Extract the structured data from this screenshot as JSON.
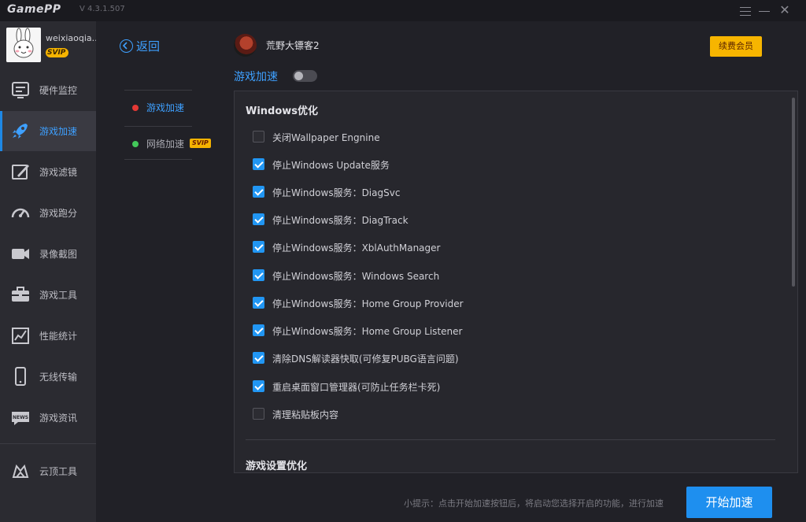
{
  "app": {
    "logo": "GamePP",
    "version": "V 4.3.1.507",
    "close_glyph": "✕"
  },
  "user": {
    "name": "weixiaoqia...",
    "badge": "SVIP"
  },
  "sidebar": {
    "items": [
      {
        "label": "硬件监控",
        "icon": "hardware-monitor-icon"
      },
      {
        "label": "游戏加速",
        "icon": "rocket-icon"
      },
      {
        "label": "游戏滤镜",
        "icon": "filter-brush-icon"
      },
      {
        "label": "游戏跑分",
        "icon": "speedometer-icon"
      },
      {
        "label": "录像截图",
        "icon": "video-camera-icon"
      },
      {
        "label": "游戏工具",
        "icon": "toolbox-icon"
      },
      {
        "label": "性能统计",
        "icon": "chart-icon"
      },
      {
        "label": "无线传输",
        "icon": "phone-icon"
      },
      {
        "label": "游戏资讯",
        "icon": "news-icon"
      },
      {
        "label": "云顶工具",
        "icon": "cloud-tool-icon"
      }
    ],
    "active_index": 1
  },
  "subnav": {
    "back_label": "返回",
    "items": [
      {
        "label": "游戏加速",
        "dot_color": "#e53935",
        "active": true
      },
      {
        "label": "网络加速",
        "dot_color": "#43c85a",
        "tag": "SVIP"
      }
    ]
  },
  "header": {
    "game_name": "荒野大镖客2",
    "renew_label": "续费会员",
    "accel_title": "游戏加速",
    "accel_enabled": false
  },
  "panel": {
    "section1_title": "Windows优化",
    "options": [
      {
        "label": "关闭Wallpaper Engnine",
        "checked": false
      },
      {
        "label": "停止Windows Update服务",
        "checked": true
      },
      {
        "label": "停止Windows服务：DiagSvc",
        "checked": true
      },
      {
        "label": "停止Windows服务：DiagTrack",
        "checked": true
      },
      {
        "label": "停止Windows服务：XblAuthManager",
        "checked": true
      },
      {
        "label": "停止Windows服务：Windows Search",
        "checked": true
      },
      {
        "label": "停止Windows服务：Home Group Provider",
        "checked": true
      },
      {
        "label": "停止Windows服务：Home Group Listener",
        "checked": true
      },
      {
        "label": "清除DNS解读器快取(可修复PUBG语言问题)",
        "checked": true
      },
      {
        "label": "重启桌面窗口管理器(可防止任务栏卡死)",
        "checked": true
      },
      {
        "label": "清理粘贴板内容",
        "checked": false
      }
    ],
    "section2_title": "游戏设置优化"
  },
  "footer": {
    "hint": "小提示：点击开始加速按钮后，将启动您选择开启的功能，进行加速",
    "start_label": "开始加速"
  },
  "colors": {
    "accent": "#1e8fef",
    "gold": "#f7b500",
    "bg": "#212127",
    "sidebar": "#2b2b31"
  }
}
